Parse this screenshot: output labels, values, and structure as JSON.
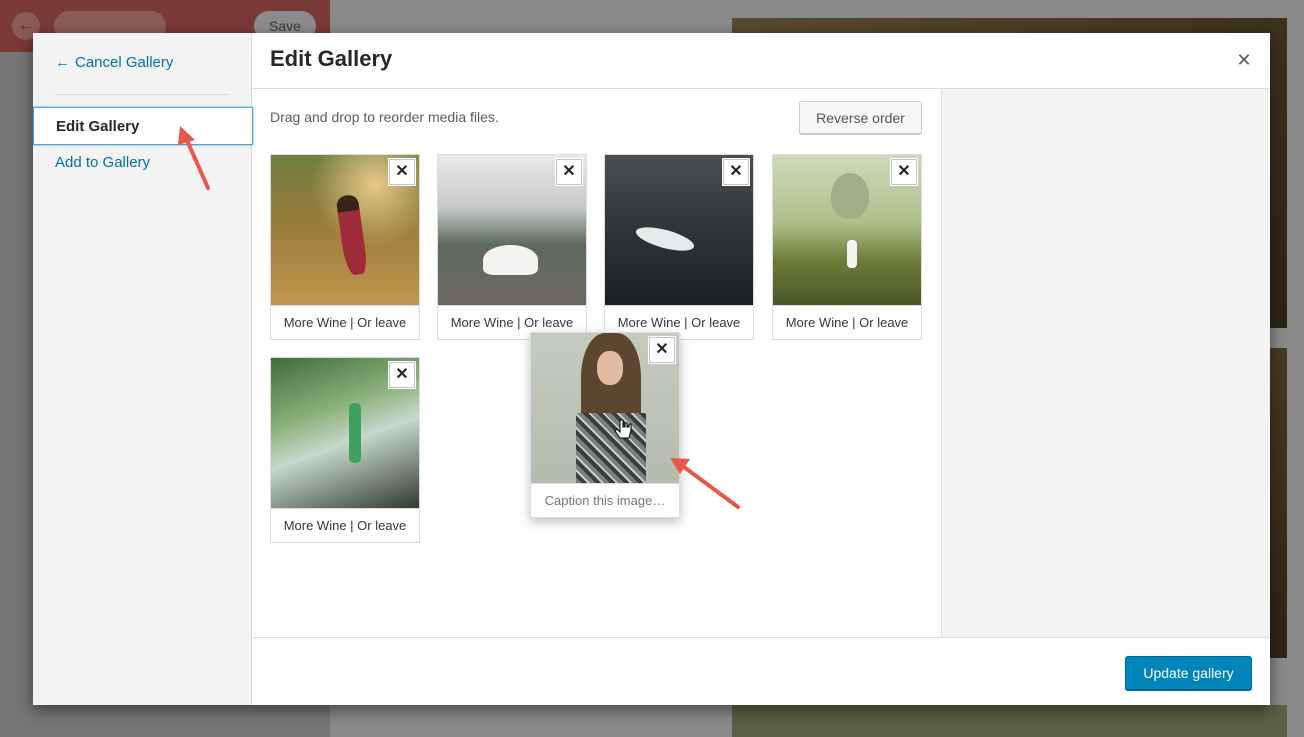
{
  "background": {
    "save_label": "Save",
    "back_icon": "arrow-left-icon",
    "collapse_icon": "chevron-left-icon"
  },
  "menu": {
    "cancel_label": "Cancel Gallery",
    "items": [
      {
        "label": "Edit Gallery",
        "active": true
      },
      {
        "label": "Add to Gallery",
        "active": false
      }
    ]
  },
  "header": {
    "title": "Edit Gallery",
    "close_icon": "close-icon"
  },
  "content": {
    "instructions": "Drag and drop to reorder media files.",
    "reverse_label": "Reverse order",
    "attachments": [
      {
        "caption": "More Wine | Or leave"
      },
      {
        "caption": "More Wine | Or leave"
      },
      {
        "caption": "More Wine | Or leave"
      },
      {
        "caption": "More Wine | Or leave"
      },
      {
        "caption": "More Wine | Or leave"
      },
      {
        "caption_placeholder": "Caption this image…",
        "dragging": true
      }
    ]
  },
  "toolbar": {
    "update_label": "Update gallery"
  },
  "colors": {
    "accent": "#0073aa",
    "primary_button": "#0085ba",
    "annotation_arrow": "#e8574a"
  }
}
